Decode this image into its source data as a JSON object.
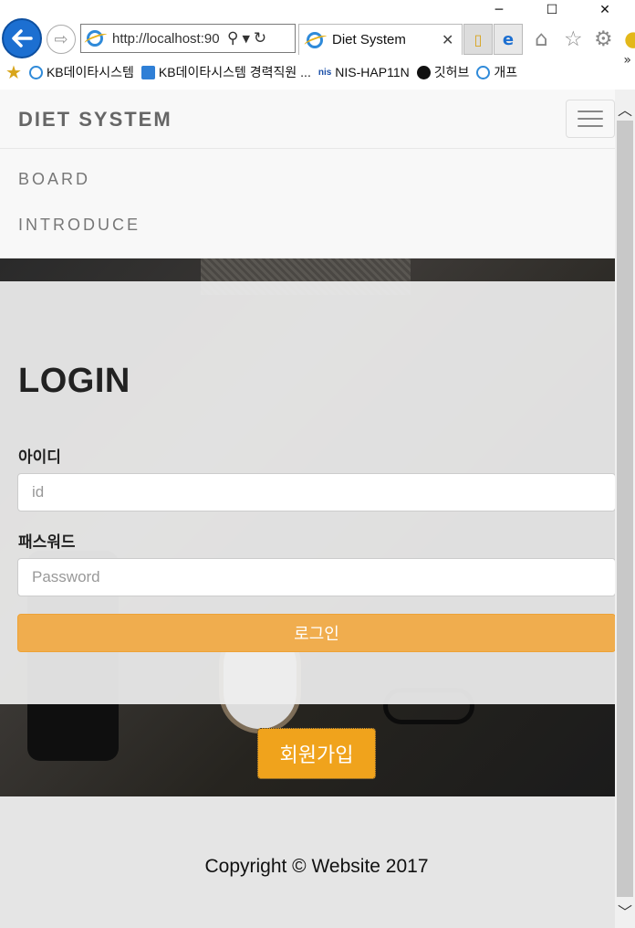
{
  "browser": {
    "address": "http://localhost:90",
    "tab_title": "Diet System",
    "window_controls": {
      "minimize": "─",
      "maximize": "☐",
      "close": "✕"
    },
    "favorites": [
      {
        "label": "KB데이타시스템",
        "icon": "ie-page-icon"
      },
      {
        "label": "KB데이타시스템 경력직원 ...",
        "icon": "blue-chat-icon"
      },
      {
        "label": "NIS-HAP11N",
        "icon": "nis-icon"
      },
      {
        "label": "깃허브",
        "icon": "github-icon"
      },
      {
        "label": "개프",
        "icon": "ie-page-icon"
      }
    ],
    "favorites_more": "»"
  },
  "site_nav": {
    "brand": "DIET SYSTEM",
    "links": [
      "BOARD",
      "INTRODUCE"
    ]
  },
  "login": {
    "title": "LOGIN",
    "id_label": "아이디",
    "id_placeholder": "id",
    "password_label": "패스워드",
    "password_placeholder": "Password",
    "submit_label": "로그인"
  },
  "join_button": "회원가입",
  "footer": {
    "copyright": "Copyright © Website 2017"
  },
  "colors": {
    "accent": "#f0ad4e",
    "join": "#f0a31c",
    "nav_bg": "#f8f8f8",
    "ie_blue": "#1c6fd1"
  }
}
